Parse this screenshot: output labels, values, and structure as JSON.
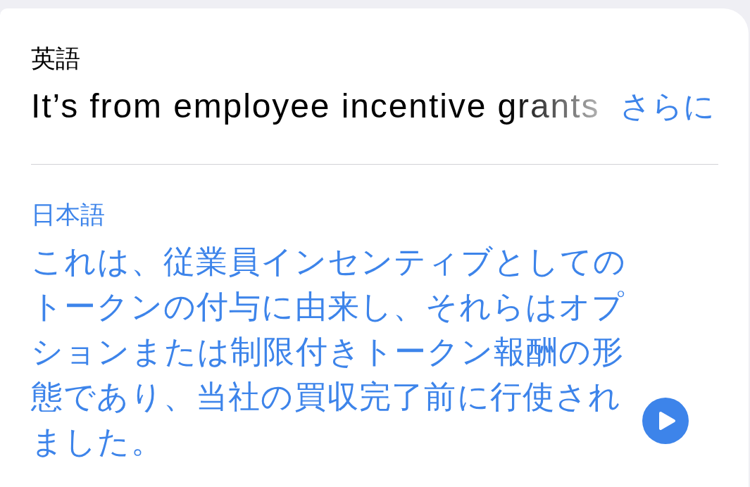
{
  "source": {
    "language": "英語",
    "text": "It’s from employee incentive grants",
    "more_label": "さらに"
  },
  "translation": {
    "language": "日本語",
    "text": "これは、従業員インセンティブとしてのトークンの付与に由来し、それらはオプションまたは制限付きトークン報酬の形態であり、当社の買収完了前に行使されました。"
  }
}
